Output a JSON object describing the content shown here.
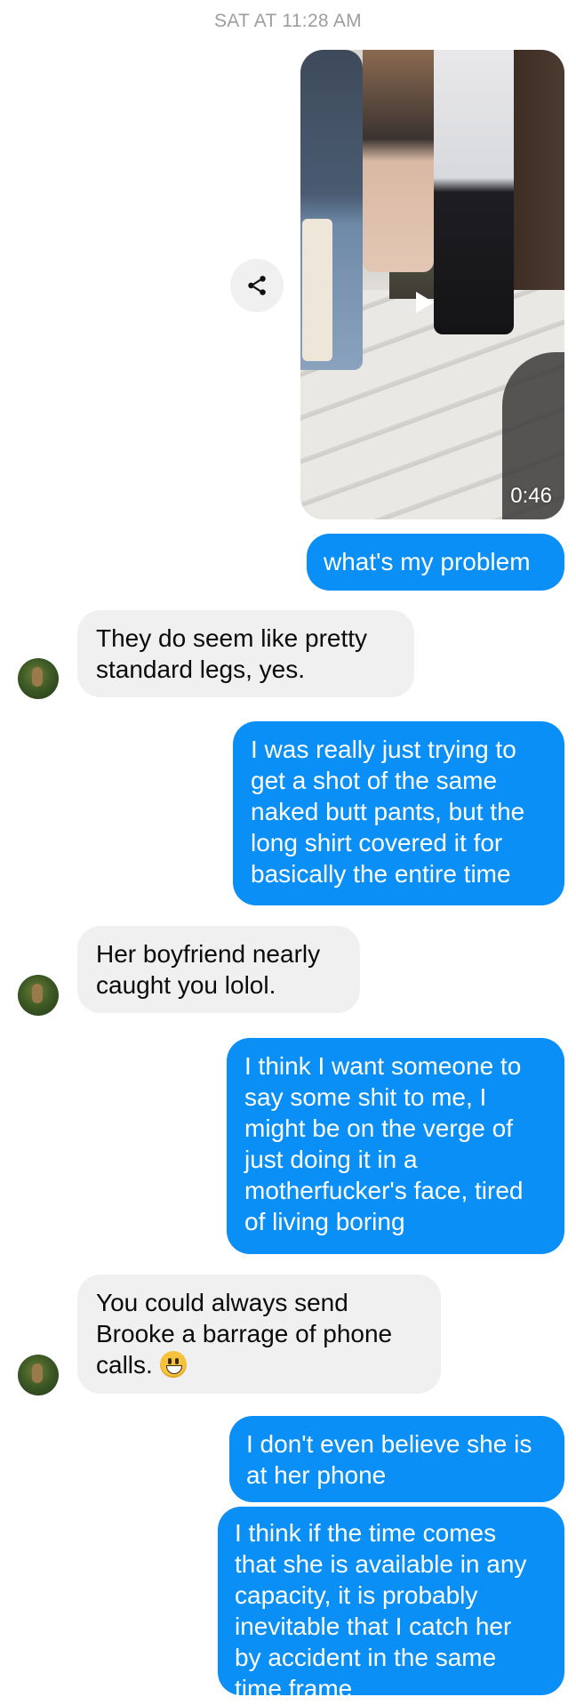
{
  "timestamp": "SAT AT 11:28 AM",
  "video": {
    "duration": "0:46",
    "play_icon": "play-icon",
    "share_icon": "share-icon"
  },
  "messages": [
    {
      "direction": "outgoing",
      "lines": [
        "what's my problem"
      ]
    },
    {
      "direction": "incoming",
      "lines": [
        "They do seem like pretty",
        "standard legs, yes."
      ]
    },
    {
      "direction": "outgoing",
      "lines": [
        "I was really just trying to",
        "get a shot of the same",
        "naked butt pants, but the",
        "long shirt covered it for",
        "basically the entire time"
      ]
    },
    {
      "direction": "incoming",
      "lines": [
        "Her boyfriend nearly",
        "caught you lolol."
      ]
    },
    {
      "direction": "outgoing",
      "lines": [
        "I think I want someone to",
        "say some shit to me, I",
        "might be on the verge of",
        "just doing it in a",
        "motherfucker's face, tired",
        "of living boring"
      ]
    },
    {
      "direction": "incoming",
      "lines": [
        "You could always send",
        "Brooke a barrage of phone",
        "calls."
      ],
      "emoji": "grinning-face-emoji"
    },
    {
      "direction": "outgoing",
      "lines": [
        "I don't even believe she is",
        "at her phone"
      ]
    },
    {
      "direction": "outgoing",
      "lines": [
        "I think if the time comes",
        "that she is available in any",
        "capacity, it is probably",
        "inevitable that I catch her",
        "by accident in the same",
        "time frame"
      ]
    }
  ],
  "colors": {
    "outgoing_bubble": "#0a8ff6",
    "incoming_bubble": "#f1f0f0",
    "timestamp_text": "#9e9e9e"
  }
}
